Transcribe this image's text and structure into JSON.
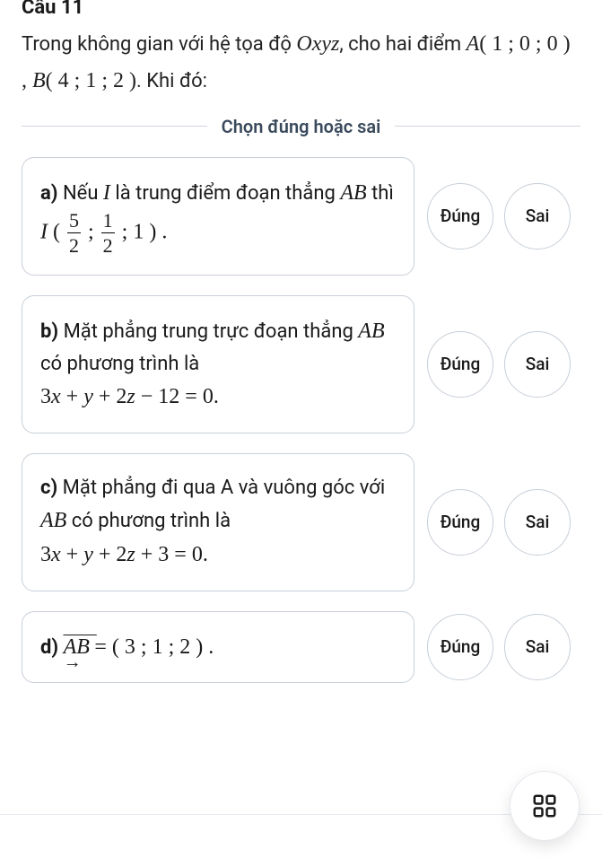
{
  "question": {
    "number_label": "Câu 11",
    "text_pre": "Trong không gian với hệ tọa độ ",
    "space": "Oxyz",
    "text_mid": ", cho hai điểm ",
    "pointA_name": "A",
    "pointA_coords": "( 1 ; 0 ; 0 )",
    "sep": " , ",
    "pointB_name": "B",
    "pointB_coords": "( 4 ; 1 ; 2 )",
    "text_post": ". Khi đó:"
  },
  "divider": {
    "label": "Chọn đúng hoặc sai"
  },
  "buttons": {
    "true": "Đúng",
    "false": "Sai"
  },
  "options": {
    "a": {
      "label": "a)",
      "pre": " Nếu ",
      "I": "I",
      "mid1": " là trung điểm đoạn thẳng ",
      "AB": "AB",
      "mid2": " thì ",
      "I2": "I",
      "open": " ( ",
      "frac1_num": "5",
      "frac1_den": "2",
      "semi1": " ; ",
      "frac2_num": "1",
      "frac2_den": "2",
      "semi2": " ; ",
      "one": "1",
      "close": " ) .",
      "answer": true
    },
    "b": {
      "label": "b)",
      "text_pre": " Mặt phẳng trung trực đoạn thẳng ",
      "AB": "AB",
      "text_mid": " có phương trình là ",
      "equation": "3x + y + 2z − 12 = 0.",
      "answer": true
    },
    "c": {
      "label": "c)",
      "text_pre": " Mặt phẳng đi qua A và vuông góc với ",
      "AB": "AB",
      "text_mid": " có phương trình là ",
      "equation": "3x + y + 2z + 3 = 0.",
      "answer": false
    },
    "d": {
      "label": "d)",
      "vec": "AB",
      "eq": " = ( 3 ; 1 ; 2 ) .",
      "answer": true
    }
  },
  "fab": {
    "name": "grid-menu"
  }
}
